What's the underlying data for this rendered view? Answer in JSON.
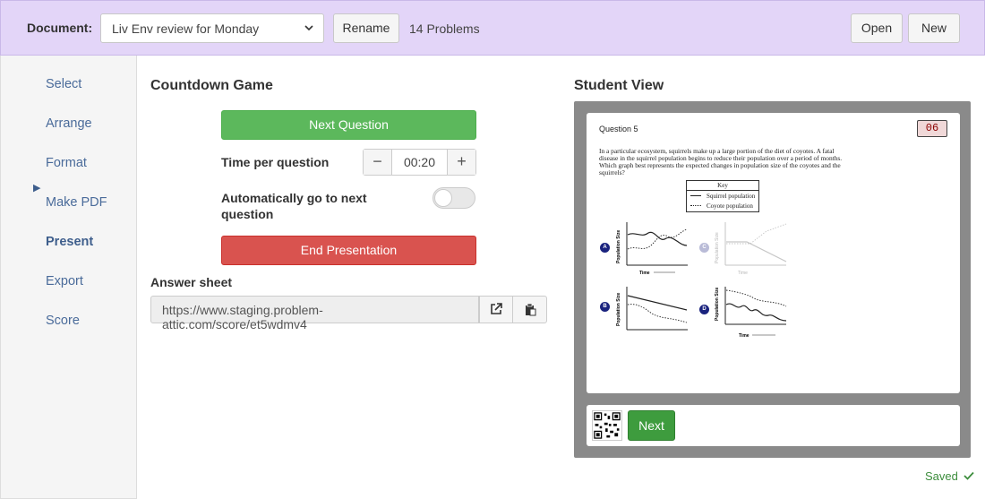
{
  "header": {
    "doc_label": "Document:",
    "doc_value": "Liv Env review for Monday",
    "rename": "Rename",
    "problems": "14 Problems",
    "open": "Open",
    "new": "New"
  },
  "sidebar": {
    "items": [
      {
        "label": "Select"
      },
      {
        "label": "Arrange"
      },
      {
        "label": "Format"
      },
      {
        "label": "Make PDF"
      },
      {
        "label": "Present",
        "active": true
      },
      {
        "label": "Export"
      },
      {
        "label": "Score"
      }
    ],
    "active_marker": "▶"
  },
  "countdown": {
    "title": "Countdown Game",
    "next_question": "Next Question",
    "time_label": "Time per question",
    "time_value": "00:20",
    "minus": "−",
    "plus": "+",
    "auto_label": "Automatically go to next question",
    "auto_enabled": false,
    "end_presentation": "End Presentation",
    "answer_label": "Answer sheet",
    "answer_url": "https://www.staging.problem-attic.com/score/et5wdmv4"
  },
  "student_view": {
    "title": "Student View",
    "question_title": "Question 5",
    "timer": "06",
    "question_text": "In a particular ecosystem, squirrels make up a large portion of the diet of coyotes. A fatal disease in the squirrel population begins to reduce their population over a period of months. Which graph best represents the expected changes in population size of the coyotes and the squirrels?",
    "key_title": "Key",
    "key_squirrel": "Squirrel population",
    "key_coyote": "Coyote population",
    "y_axis": "Population Size",
    "x_axis": "Time",
    "options": [
      "A",
      "B",
      "C",
      "D"
    ],
    "next": "Next"
  },
  "status": {
    "saved": "Saved"
  },
  "colors": {
    "topbar": "#e3d5f8",
    "green": "#5cb85c",
    "red": "#d9534f",
    "link": "#4a6b9a"
  }
}
